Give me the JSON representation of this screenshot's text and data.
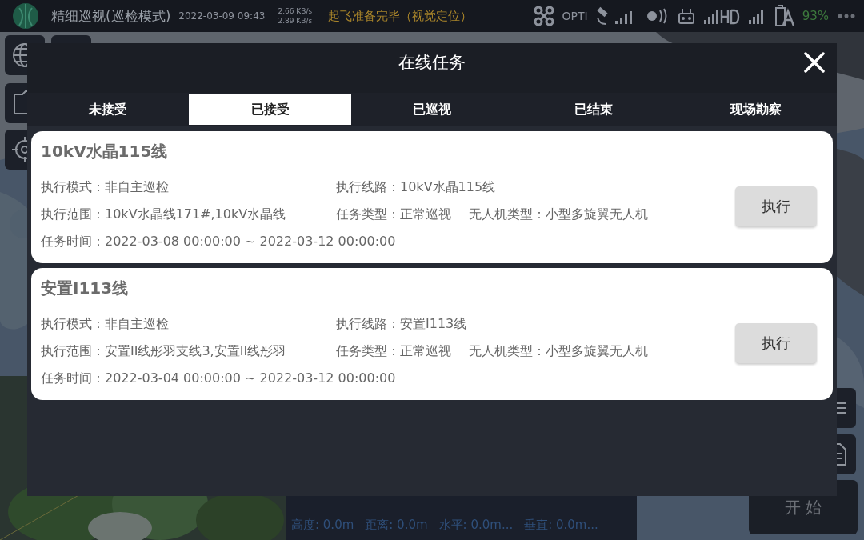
{
  "status_bar": {
    "title": "精细巡视(巡检模式)",
    "datetime": "2022-03-09 09:43",
    "upload_rate": "2.66 KB/s",
    "download_rate": "2.89 KB/s",
    "message": "起飞准备完毕（视觉定位）",
    "positioning": "OPTI",
    "battery": "93%"
  },
  "telemetry": {
    "readings": [
      "高度: 0.0m",
      "距离: 0.0m",
      "水平: 0.0m...",
      "垂直: 0.0m..."
    ]
  },
  "start_button": "开 始",
  "dialog": {
    "title": "在线任务",
    "tabs": [
      {
        "label": "未接受",
        "selected": false
      },
      {
        "label": "已接受",
        "selected": true
      },
      {
        "label": "已巡视",
        "selected": false
      },
      {
        "label": "已结束",
        "selected": false
      },
      {
        "label": "现场勘察",
        "selected": false
      }
    ],
    "tasks": [
      {
        "name": "10kV水晶115线",
        "rows": [
          [
            "执行模式：非自主巡检",
            "执行线路：10kV水晶115线"
          ],
          [
            "执行范围：10kV水晶线171#,10kV水晶线",
            "任务类型：正常巡视",
            "无人机类型：小型多旋翼无人机"
          ],
          [
            "任务时间：2022-03-08 00:00:00 ~ 2022-03-12 00:00:00"
          ]
        ],
        "action": "执行"
      },
      {
        "name": "安置I113线",
        "rows": [
          [
            "执行模式：非自主巡检",
            "执行线路：安置I113线"
          ],
          [
            "执行范围：安置II线彤羽支线3,安置II线彤羽",
            "任务类型：正常巡视",
            "无人机类型：小型多旋翼无人机"
          ],
          [
            "任务时间：2022-03-04 00:00:00 ~ 2022-03-12 00:00:00"
          ]
        ],
        "action": "执行"
      }
    ]
  }
}
